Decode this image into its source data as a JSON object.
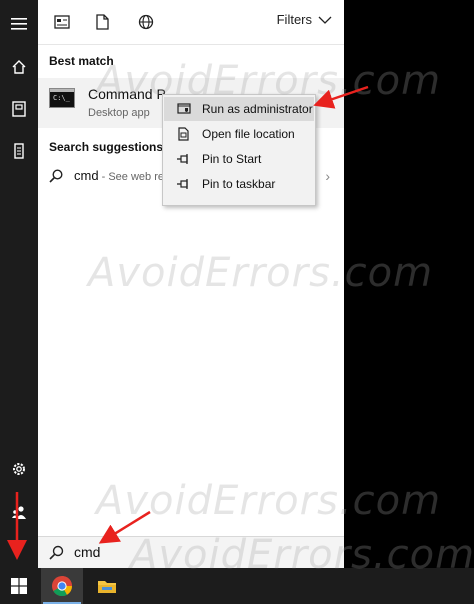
{
  "toolbar": {
    "filters_label": "Filters"
  },
  "best_match": {
    "heading": "Best match",
    "title": "Command P",
    "subtitle": "Desktop app",
    "icon_text": "C:\\_"
  },
  "suggestions": {
    "heading": "Search suggestions",
    "query": "cmd",
    "hint": " - See web re"
  },
  "context_menu": {
    "items": [
      {
        "label": "Run as administrator"
      },
      {
        "label": "Open file location"
      },
      {
        "label": "Pin to Start"
      },
      {
        "label": "Pin to taskbar"
      }
    ]
  },
  "search": {
    "value": "cmd"
  },
  "watermark": {
    "text": "AvoidErrors.com"
  },
  "colors": {
    "annotation_arrow": "#e8221e",
    "rail_bg": "#1c1c1c",
    "menu_hover": "#dadada"
  }
}
